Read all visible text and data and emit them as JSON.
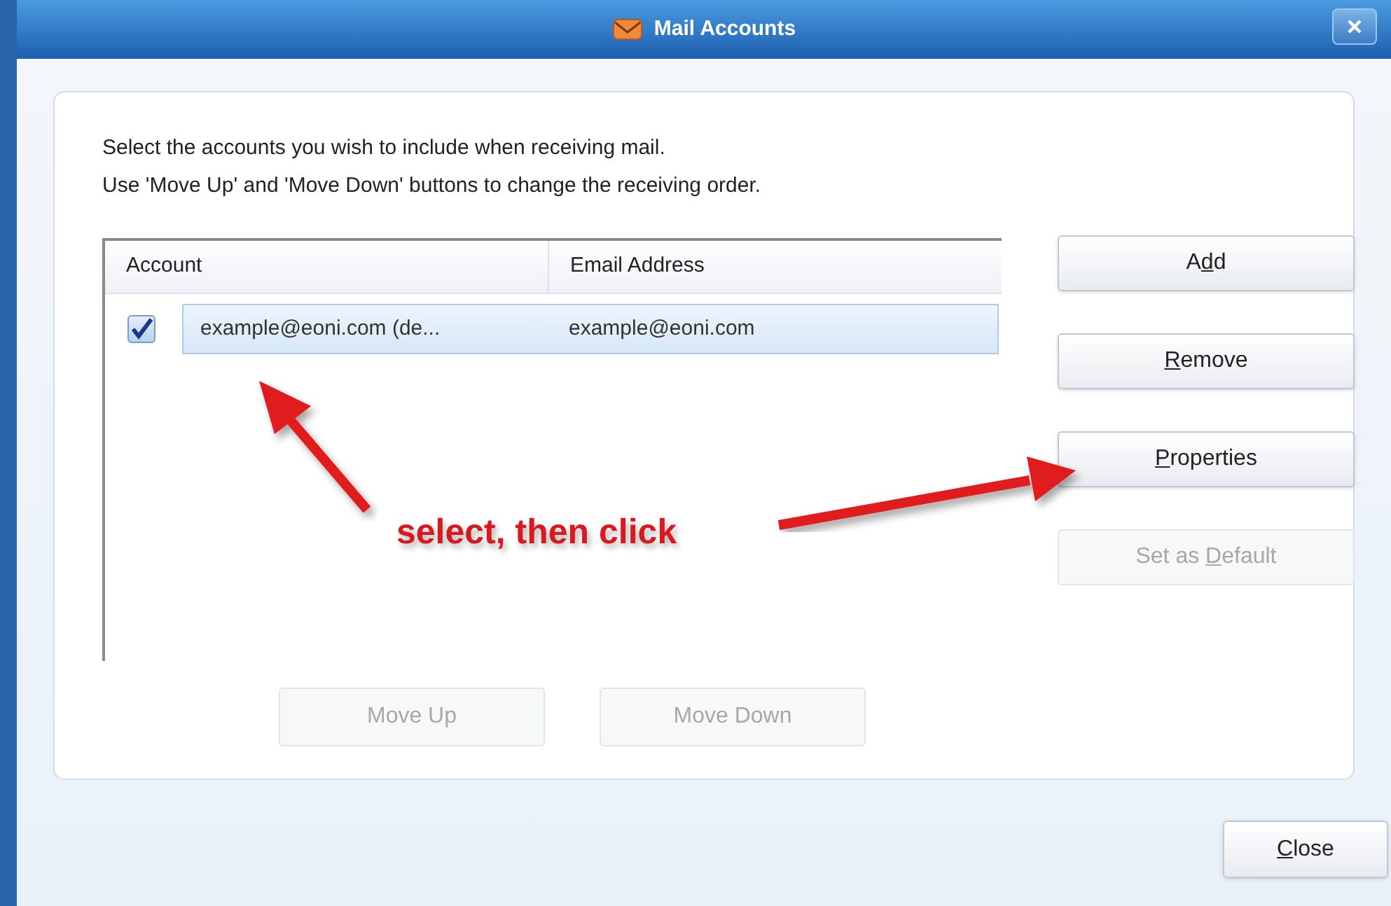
{
  "window": {
    "title": "Mail Accounts"
  },
  "instructions": [
    "Select the accounts you wish to include when receiving mail.",
    "Use 'Move Up' and 'Move Down' buttons to change the receiving order."
  ],
  "table": {
    "columns": [
      "Account",
      "Email Address"
    ],
    "rows": [
      {
        "checked": true,
        "selected": true,
        "cells": [
          "example@eoni.com (de...",
          "example@eoni.com"
        ]
      }
    ]
  },
  "side_buttons": [
    {
      "before": "A",
      "key": "d",
      "after": "d",
      "disabled": false
    },
    {
      "key": "R",
      "after": "emove",
      "disabled": false
    },
    {
      "key": "P",
      "after": "roperties",
      "disabled": false
    },
    {
      "before": "Set as ",
      "key": "D",
      "after": "efault",
      "disabled": true
    }
  ],
  "order_buttons": [
    {
      "before": "Move Up",
      "disabled": true
    },
    {
      "before": "Move Down",
      "disabled": true
    }
  ],
  "close_button": {
    "key": "C",
    "after": "lose",
    "disabled": false
  },
  "annotation": {
    "text": "select, then click"
  }
}
